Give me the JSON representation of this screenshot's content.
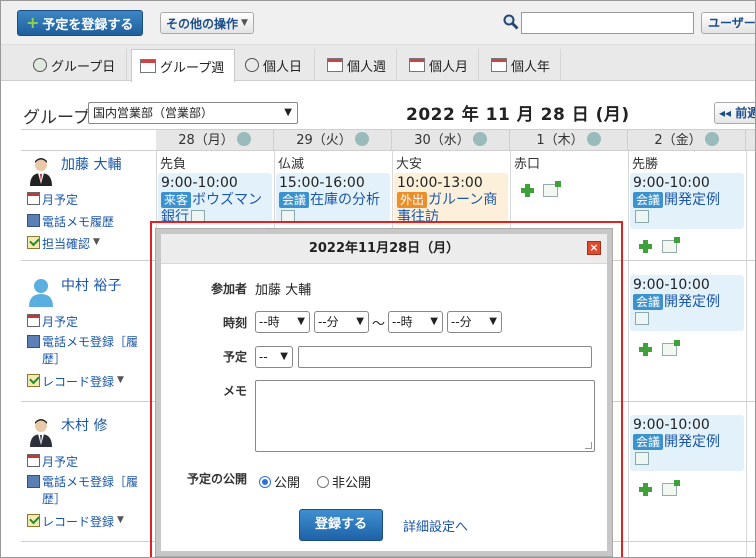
{
  "toolbar": {
    "add_label": "予定を登録する",
    "other_label": "その他の操作",
    "search_placeholder": "",
    "user_label": "ユーザー/"
  },
  "tabs": [
    {
      "label": "グループ日",
      "icon": "group-day-icon"
    },
    {
      "label": "グループ週",
      "icon": "group-week-icon",
      "active": true
    },
    {
      "label": "個人日",
      "icon": "clock-icon"
    },
    {
      "label": "個人週",
      "icon": "calendar-week-icon"
    },
    {
      "label": "個人月",
      "icon": "calendar-month-icon"
    },
    {
      "label": "個人年",
      "icon": "calendar-year-icon"
    }
  ],
  "header": {
    "group_label": "グループ",
    "group_select": "国内営業部（営業部）",
    "date_title": "2022 年 11 月 28 日 (月)",
    "prev_label": "◂◂ 前週"
  },
  "days": [
    {
      "label": "28（月）",
      "rokuyo": "先負"
    },
    {
      "label": "29（火）",
      "rokuyo": "仏滅"
    },
    {
      "label": "30（水）",
      "rokuyo": "大安"
    },
    {
      "label": "1（木）",
      "rokuyo": "赤口"
    },
    {
      "label": "2（金）",
      "rokuyo": "先勝"
    }
  ],
  "users": [
    {
      "name": "加藤 大輔",
      "links": [
        "月予定",
        "電話メモ履歴",
        "担当確認"
      ]
    },
    {
      "name": "中村 裕子",
      "links": [
        "月予定",
        "電話メモ登録［履歴］",
        "レコード登録"
      ]
    },
    {
      "name": "木村 修",
      "links": [
        "月予定",
        "電話メモ登録［履歴］",
        "レコード登録"
      ]
    }
  ],
  "events": {
    "u1_mon": {
      "time": "9:00-10:00",
      "tag": "来客",
      "title": "ボウズマン",
      "title2": "銀行"
    },
    "u1_tue": {
      "time": "15:00-16:00",
      "tag": "会議",
      "title": "在庫の分析"
    },
    "u1_wed": {
      "time": "10:00-13:00",
      "tag": "外出",
      "title": "ガルーン商",
      "title2": "事往訪"
    },
    "u1_fri": {
      "time": "9:00-10:00",
      "tag": "会議",
      "title": "開発定例"
    },
    "u2_fri": {
      "time": "9:00-10:00",
      "tag": "会議",
      "title": "開発定例"
    },
    "u3_fri": {
      "time": "9:00-10:00",
      "tag": "会議",
      "title": "開発定例"
    }
  },
  "modal": {
    "title": "2022年11月28日（月）",
    "participant_label": "参加者",
    "participant_value": "加藤 大輔",
    "time_label": "時刻",
    "hour_sel": "--時",
    "min_sel": "--分",
    "tilde": "〜",
    "hour_sel2": "--時",
    "min_sel2": "--分",
    "plan_label": "予定",
    "plan_sel": "--",
    "memo_label": "メモ",
    "publish_label": "予定の公開",
    "public_label": "公開",
    "private_label": "非公開",
    "register_label": "登録する",
    "detail_label": "詳細設定へ"
  },
  "colors": {
    "primary": "#1f5f9c",
    "tag_blue": "#3b92cf",
    "tag_orange": "#ea8f2c",
    "highlight_border": "#dd2222"
  }
}
